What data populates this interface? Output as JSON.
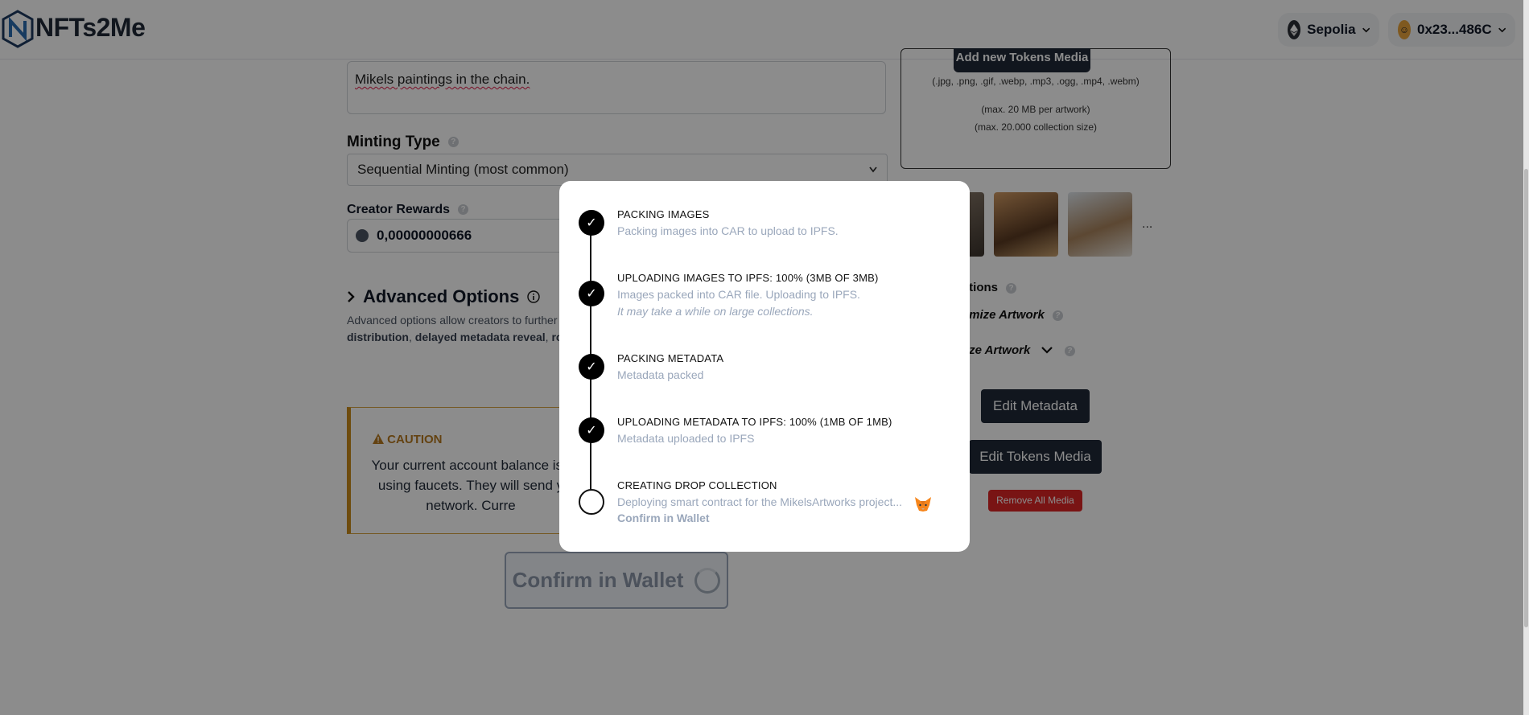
{
  "header": {
    "logo_text": "NFTs2Me",
    "network": "Sepolia",
    "account": "0x23...486C"
  },
  "form": {
    "description_value": "Mikels paintings in the chain.",
    "minting_type_label": "Minting Type",
    "minting_type_value": "Sequential Minting (most common)",
    "creator_rewards_label": "Creator Rewards",
    "creator_rewards_value": "0,00000000666",
    "advanced_options_label": "Advanced Options",
    "advanced_desc_start": "Advanced options allow creators to further",
    "advanced_desc_link1": "distribution",
    "advanced_desc_link2": "delayed metadata reveal",
    "advanced_desc_link3": "ro"
  },
  "caution": {
    "title": "CAUTION",
    "line1": "Your current account balance is t",
    "line2": "using faucets. They will send y",
    "line3": "network. Curre"
  },
  "confirm_button": "Confirm in Wallet",
  "right_panel": {
    "add_media_button": "Add new Tokens Media",
    "formats": "(.jpg, .png, .gif, .webp, .mp3, .ogg, .mp4, .webm)",
    "max_artwork": "(max. 20 MB per artwork)",
    "max_collection": "(max. 20.000 collection size)",
    "more": "...",
    "options_label": "ptions",
    "optimize_label": "timize Artwork",
    "randomize_label": "ize Artwork",
    "edit_metadata_button": "Edit Metadata",
    "edit_tokens_button": "Edit Tokens Media",
    "remove_media_button": "Remove All Media"
  },
  "modal": {
    "steps": [
      {
        "title": "PACKING IMAGES",
        "desc": "Packing images into CAR to upload to IPFS.",
        "status": "done"
      },
      {
        "title": "UPLOADING IMAGES TO IPFS: 100% (3MB OF 3MB)",
        "desc": "Images packed into CAR file. Uploading to IPFS.",
        "note": "It may take a while on large collections.",
        "status": "done"
      },
      {
        "title": "PACKING METADATA",
        "desc": "Metadata packed",
        "status": "done"
      },
      {
        "title": "UPLOADING METADATA TO IPFS: 100% (1MB OF 1MB)",
        "desc": "Metadata uploaded to IPFS",
        "status": "done"
      },
      {
        "title": "CREATING DROP COLLECTION",
        "desc": "Deploying smart contract for the MikelsArtworks project...",
        "action": "Confirm in Wallet",
        "status": "pending"
      }
    ]
  },
  "icons": {
    "check": "check-icon",
    "fox": "metamask-fox-icon"
  },
  "colors": {
    "primary_dark": "#1f2937",
    "caution": "#c98a1a",
    "danger": "#dc2626",
    "muted": "#9aa7bb"
  }
}
